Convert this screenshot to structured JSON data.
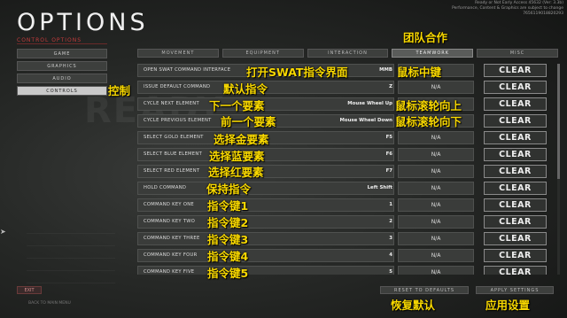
{
  "header": {
    "title": "OPTIONS",
    "subtitle": "CONTROL OPTIONS",
    "version_lines": [
      "Ready or Not Early Access 45632 (Ver: 3.3b)",
      "Performance, Content & Graphics are subject to change",
      "7656119018820293"
    ]
  },
  "background": {
    "watermark": "READY"
  },
  "nav": {
    "items": [
      {
        "label": "GAME",
        "active": false
      },
      {
        "label": "GRAPHICS",
        "active": false
      },
      {
        "label": "AUDIO",
        "active": false
      },
      {
        "label": "CONTROLS",
        "active": true
      }
    ],
    "exit_label": "EXIT",
    "exit_hint": "BACK TO MAIN MENU"
  },
  "tabs": [
    {
      "label": "MOVEMENT",
      "active": false
    },
    {
      "label": "EQUIPMENT",
      "active": false
    },
    {
      "label": "INTERACTION",
      "active": false
    },
    {
      "label": "TEAMWORK",
      "active": true
    },
    {
      "label": "MISC",
      "active": false
    }
  ],
  "bindings": [
    {
      "action": "OPEN SWAT COMMAND INTERFACE",
      "key": "MMB",
      "alt": "N/A",
      "clear": "CLEAR"
    },
    {
      "action": "ISSUE DEFAULT COMMAND",
      "key": "Z",
      "alt": "N/A",
      "clear": "CLEAR"
    },
    {
      "action": "CYCLE NEXT ELEMENT",
      "key": "Mouse Wheel Up",
      "alt": "N/A",
      "clear": "CLEAR"
    },
    {
      "action": "CYCLE PREVIOUS ELEMENT",
      "key": "Mouse Wheel Down",
      "alt": "N/A",
      "clear": "CLEAR"
    },
    {
      "action": "SELECT GOLD ELEMENT",
      "key": "F5",
      "alt": "N/A",
      "clear": "CLEAR"
    },
    {
      "action": "SELECT BLUE ELEMENT",
      "key": "F6",
      "alt": "N/A",
      "clear": "CLEAR"
    },
    {
      "action": "SELECT RED ELEMENT",
      "key": "F7",
      "alt": "N/A",
      "clear": "CLEAR"
    },
    {
      "action": "HOLD COMMAND",
      "key": "Left Shift",
      "alt": "N/A",
      "clear": "CLEAR"
    },
    {
      "action": "COMMAND KEY ONE",
      "key": "1",
      "alt": "N/A",
      "clear": "CLEAR"
    },
    {
      "action": "COMMAND KEY TWO",
      "key": "2",
      "alt": "N/A",
      "clear": "CLEAR"
    },
    {
      "action": "COMMAND KEY THREE",
      "key": "3",
      "alt": "N/A",
      "clear": "CLEAR"
    },
    {
      "action": "COMMAND KEY FOUR",
      "key": "4",
      "alt": "N/A",
      "clear": "CLEAR"
    },
    {
      "action": "COMMAND KEY FIVE",
      "key": "5",
      "alt": "N/A",
      "clear": "CLEAR"
    }
  ],
  "footer": {
    "reset_label": "RESET TO DEFAULTS",
    "apply_label": "APPLY SETTINGS"
  },
  "annotations": {
    "tab_teamwork": "团队合作",
    "nav_controls": "控制",
    "open_swat": "打开SWAT指令界面",
    "mmb": "鼠标中键",
    "issue_default": "默认指令",
    "next_element": "下一个要素",
    "wheel_up": "鼠标滚轮向上",
    "prev_element": "前一个要素",
    "wheel_down": "鼠标滚轮向下",
    "gold": "选择金要素",
    "blue": "选择蓝要素",
    "red": "选择红要素",
    "hold": "保持指令",
    "key1": "指令键1",
    "key2": "指令键2",
    "key3": "指令键3",
    "key4": "指令键4",
    "key5": "指令键5",
    "reset": "恢复默认",
    "apply": "应用设置"
  },
  "colors": {
    "accent": "#c23b3b",
    "annotation": "#f8d800",
    "active_nav": "#c9c9c9"
  }
}
